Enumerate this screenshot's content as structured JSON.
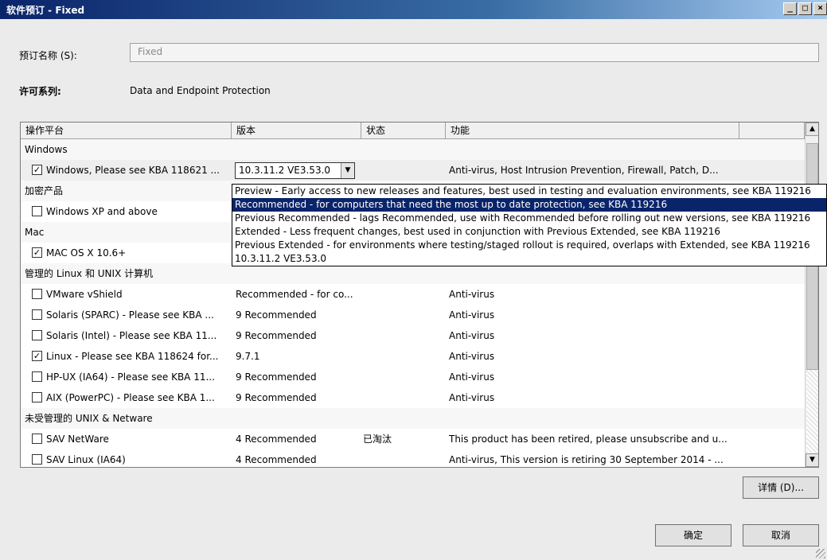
{
  "window": {
    "title": "软件预订 - Fixed",
    "controls": [
      "_",
      "□",
      "×"
    ]
  },
  "form": {
    "name_label": "预订名称 (S):",
    "name_value": "Fixed",
    "license_label": "许可系列:",
    "license_value": "Data and Endpoint Protection"
  },
  "grid": {
    "headers": [
      "操作平台",
      "版本",
      "状态",
      "功能"
    ],
    "rows": [
      {
        "kind": "group",
        "name": "Windows"
      },
      {
        "kind": "item",
        "checked": true,
        "platform": "Windows, Please see KBA 118621 ...",
        "version": "10.3.11.2 VE3.53.0",
        "status": "",
        "features": "Anti-virus, Host Intrusion Prevention, Firewall, Patch, D...",
        "combo": true
      },
      {
        "kind": "group",
        "name": "加密产品"
      },
      {
        "kind": "item",
        "checked": false,
        "platform": "Windows XP and above",
        "version": "",
        "status": "",
        "features": ""
      },
      {
        "kind": "group",
        "name": "Mac"
      },
      {
        "kind": "item",
        "checked": true,
        "platform": "MAC OS X 10.6+",
        "version": "",
        "status": "",
        "features": ""
      },
      {
        "kind": "group",
        "name": "管理的 Linux 和 UNIX 计算机"
      },
      {
        "kind": "item",
        "checked": false,
        "platform": "VMware vShield",
        "version": "Recommended - for co...",
        "status": "",
        "features": "Anti-virus"
      },
      {
        "kind": "item",
        "checked": false,
        "platform": "Solaris (SPARC) - Please see KBA ...",
        "version": "9 Recommended",
        "status": "",
        "features": "Anti-virus"
      },
      {
        "kind": "item",
        "checked": false,
        "platform": "Solaris (Intel) - Please see KBA 11...",
        "version": "9 Recommended",
        "status": "",
        "features": "Anti-virus"
      },
      {
        "kind": "item",
        "checked": true,
        "platform": "Linux - Please see KBA 118624 for...",
        "version": "9.7.1",
        "status": "",
        "features": "Anti-virus"
      },
      {
        "kind": "item",
        "checked": false,
        "platform": "HP-UX (IA64) - Please see KBA 11...",
        "version": "9 Recommended",
        "status": "",
        "features": "Anti-virus"
      },
      {
        "kind": "item",
        "checked": false,
        "platform": "AIX (PowerPC) - Please see KBA 1...",
        "version": "9 Recommended",
        "status": "",
        "features": "Anti-virus"
      },
      {
        "kind": "group",
        "name": "未受管理的 UNIX & Netware"
      },
      {
        "kind": "item",
        "checked": false,
        "platform": "SAV NetWare",
        "version": "4 Recommended",
        "status": "已淘汰",
        "features": "This product has been retired, please unsubscribe and u..."
      },
      {
        "kind": "item",
        "checked": false,
        "platform": "SAV Linux (IA64)",
        "version": "4 Recommended",
        "status": "",
        "features": "Anti-virus, This version is retiring 30 September 2014 - ..."
      }
    ]
  },
  "dropdown": {
    "selected_index": 1,
    "options": [
      "Preview - Early access to new releases and features, best used in testing and evaluation environments, see KBA 119216",
      "Recommended - for computers that need the most up to date protection, see KBA 119216",
      "Previous Recommended - lags Recommended, use with Recommended before rolling out new versions, see KBA 119216",
      "Extended - Less frequent changes, best used in conjunction with Previous Extended, see KBA 119216",
      "Previous Extended - for environments where testing/staged rollout is required, overlaps with Extended, see KBA 119216",
      "10.3.11.2 VE3.53.0"
    ]
  },
  "buttons": {
    "details": "详情 (D)...",
    "ok": "确定",
    "cancel": "取消"
  },
  "icons": {
    "check": "✓",
    "combo_arrow": "▼",
    "scroll_up": "▲",
    "scroll_down": "▼"
  }
}
